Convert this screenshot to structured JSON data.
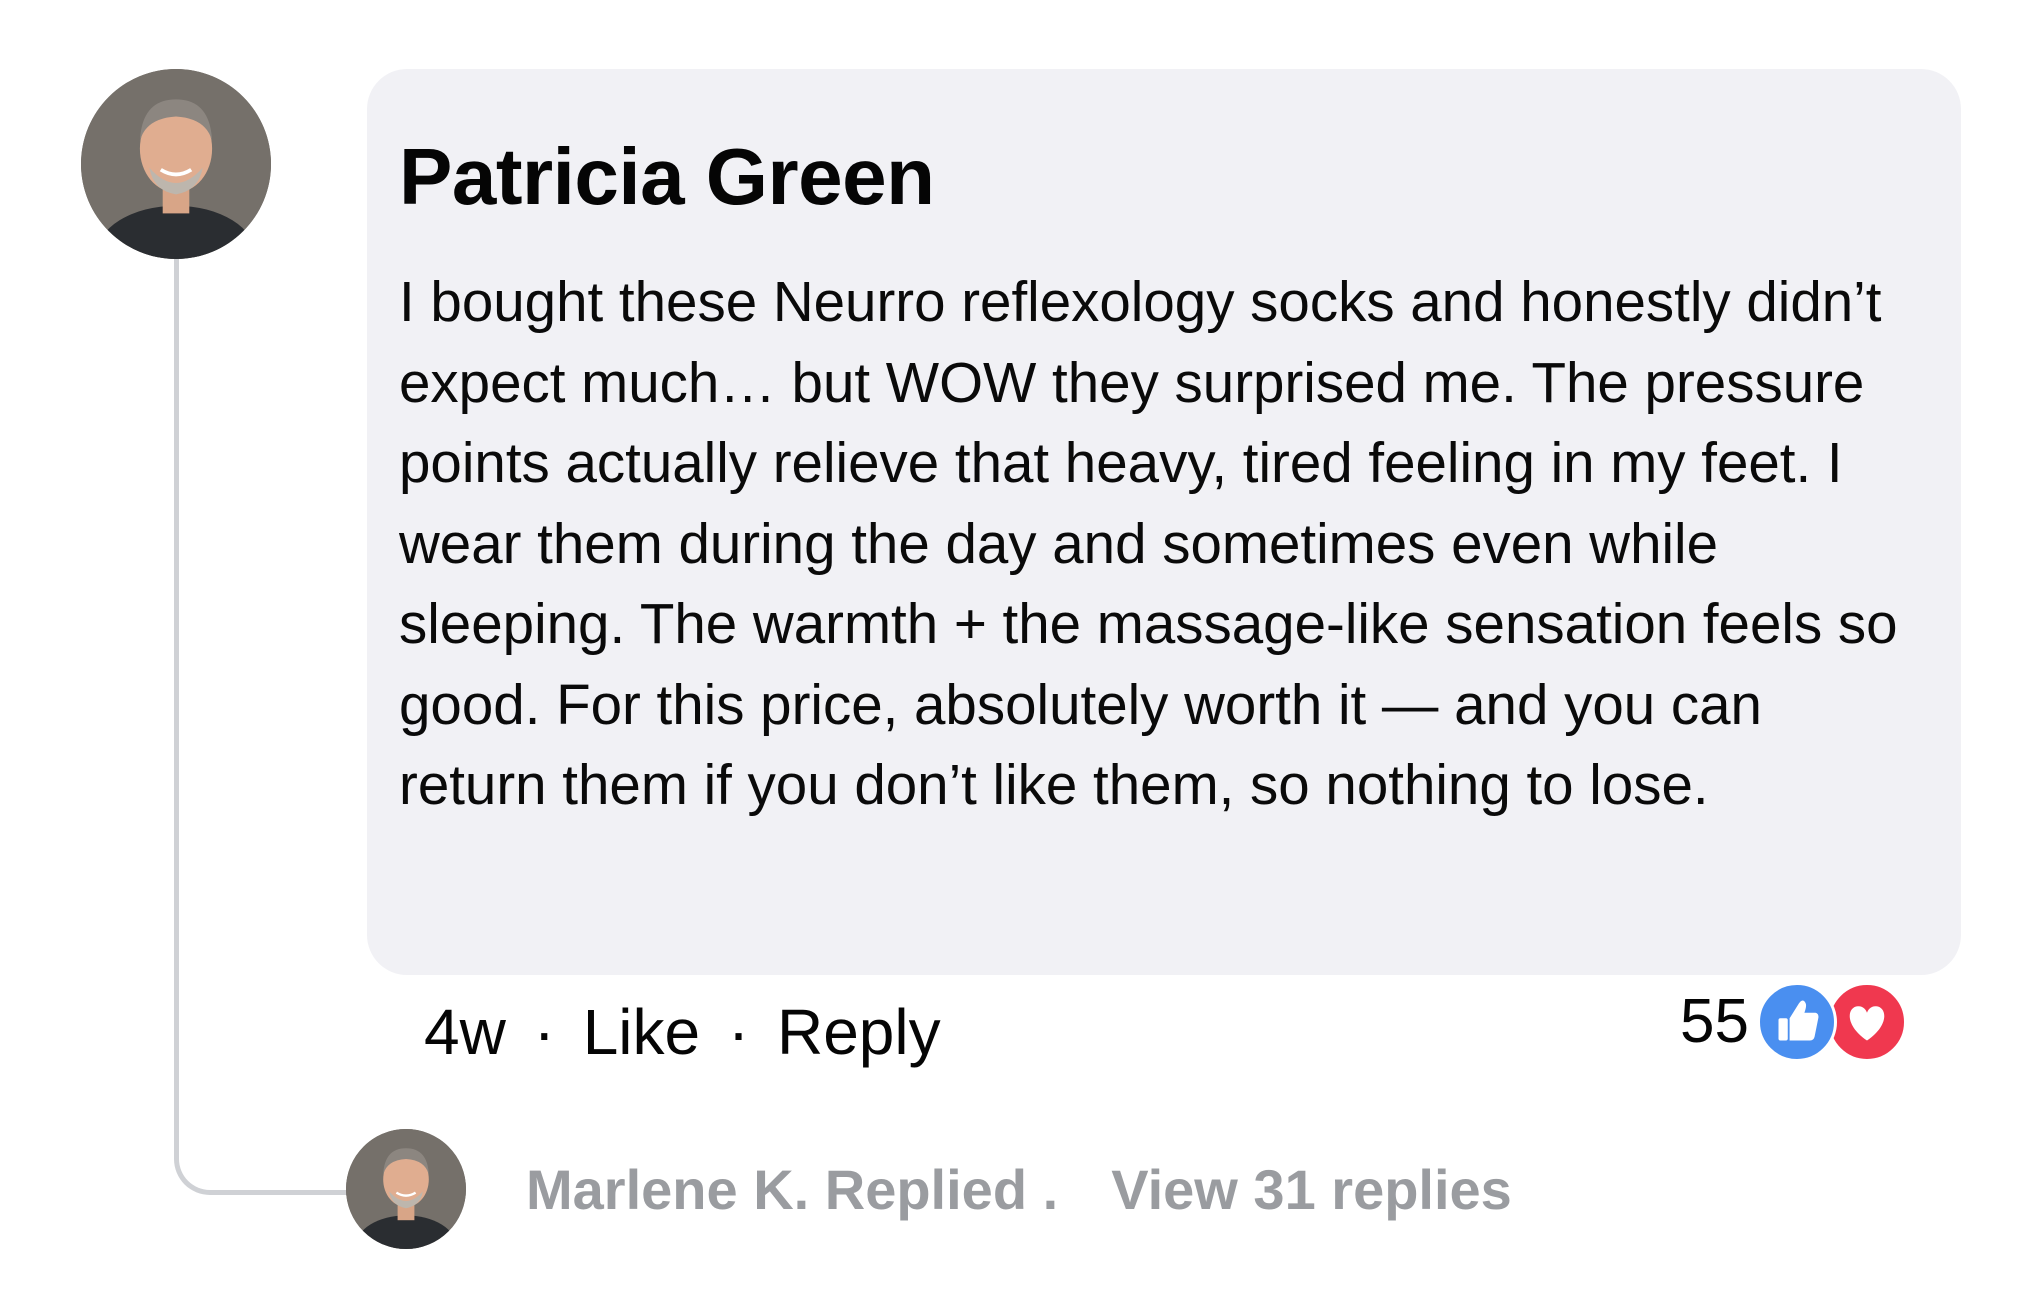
{
  "comment": {
    "author": "Patricia Green",
    "text": "I bought these Neurro reflexology socks and honestly didn’t expect much… but WOW they surprised me. The pressure points actually relieve that heavy, tired feeling in my feet. I wear them during the day and sometimes even while sleeping. The warmth + the massage-like sensation feels so good. For this price, absolutely worth it — and you can return them if you don’t like them, so nothing to lose.",
    "time": "4w",
    "separator": "·",
    "like_label": "Like",
    "reply_label": "Reply",
    "reaction_count": "55",
    "reaction_icons": [
      "like-icon",
      "love-icon"
    ]
  },
  "reply_preview": {
    "replier_text": "Marlene K. Replied .",
    "view_replies": "View 31 replies"
  },
  "colors": {
    "bubble_bg": "#f1f1f5",
    "like_blue": "#4a8ff0",
    "love_red": "#f0384f",
    "muted_text": "#9a9ca0",
    "thread_line": "#cfd1d5"
  }
}
